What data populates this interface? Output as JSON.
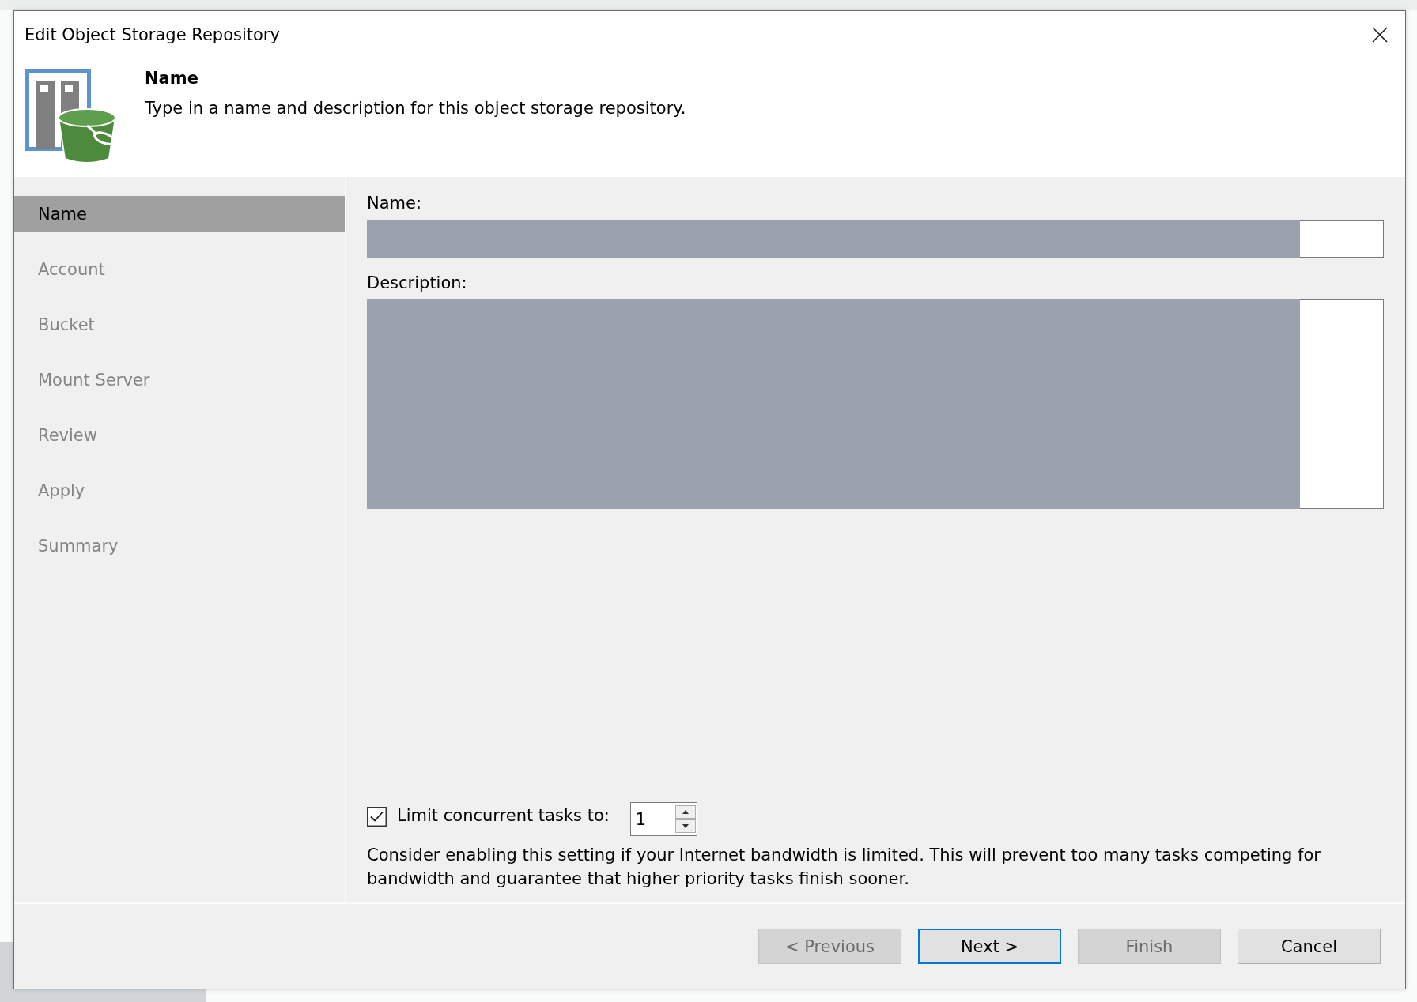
{
  "window": {
    "title": "Edit Object Storage Repository"
  },
  "header": {
    "title": "Name",
    "description": "Type in a name and description for this object storage repository."
  },
  "steps": [
    {
      "label": "Name",
      "selected": true
    },
    {
      "label": "Account",
      "selected": false
    },
    {
      "label": "Bucket",
      "selected": false
    },
    {
      "label": "Mount Server",
      "selected": false
    },
    {
      "label": "Review",
      "selected": false
    },
    {
      "label": "Apply",
      "selected": false
    },
    {
      "label": "Summary",
      "selected": false
    }
  ],
  "fields": [
    {
      "label": "Name:",
      "kind": "line",
      "redacted": true
    },
    {
      "label": "Description:",
      "kind": "area",
      "redacted": true
    }
  ],
  "limit_tasks": {
    "label": "Limit concurrent tasks to:",
    "checked": true,
    "value": "1"
  },
  "hint": "Consider enabling this setting if your Internet bandwidth is limited. This will prevent too many tasks competing for bandwidth and guarantee that higher priority tasks finish sooner.",
  "buttons": [
    {
      "label": "< Previous",
      "disabled": true,
      "default": false
    },
    {
      "label": "Next >",
      "disabled": false,
      "default": true
    },
    {
      "label": "Finish",
      "disabled": true,
      "default": false
    },
    {
      "label": "Cancel",
      "disabled": false,
      "default": false
    }
  ]
}
